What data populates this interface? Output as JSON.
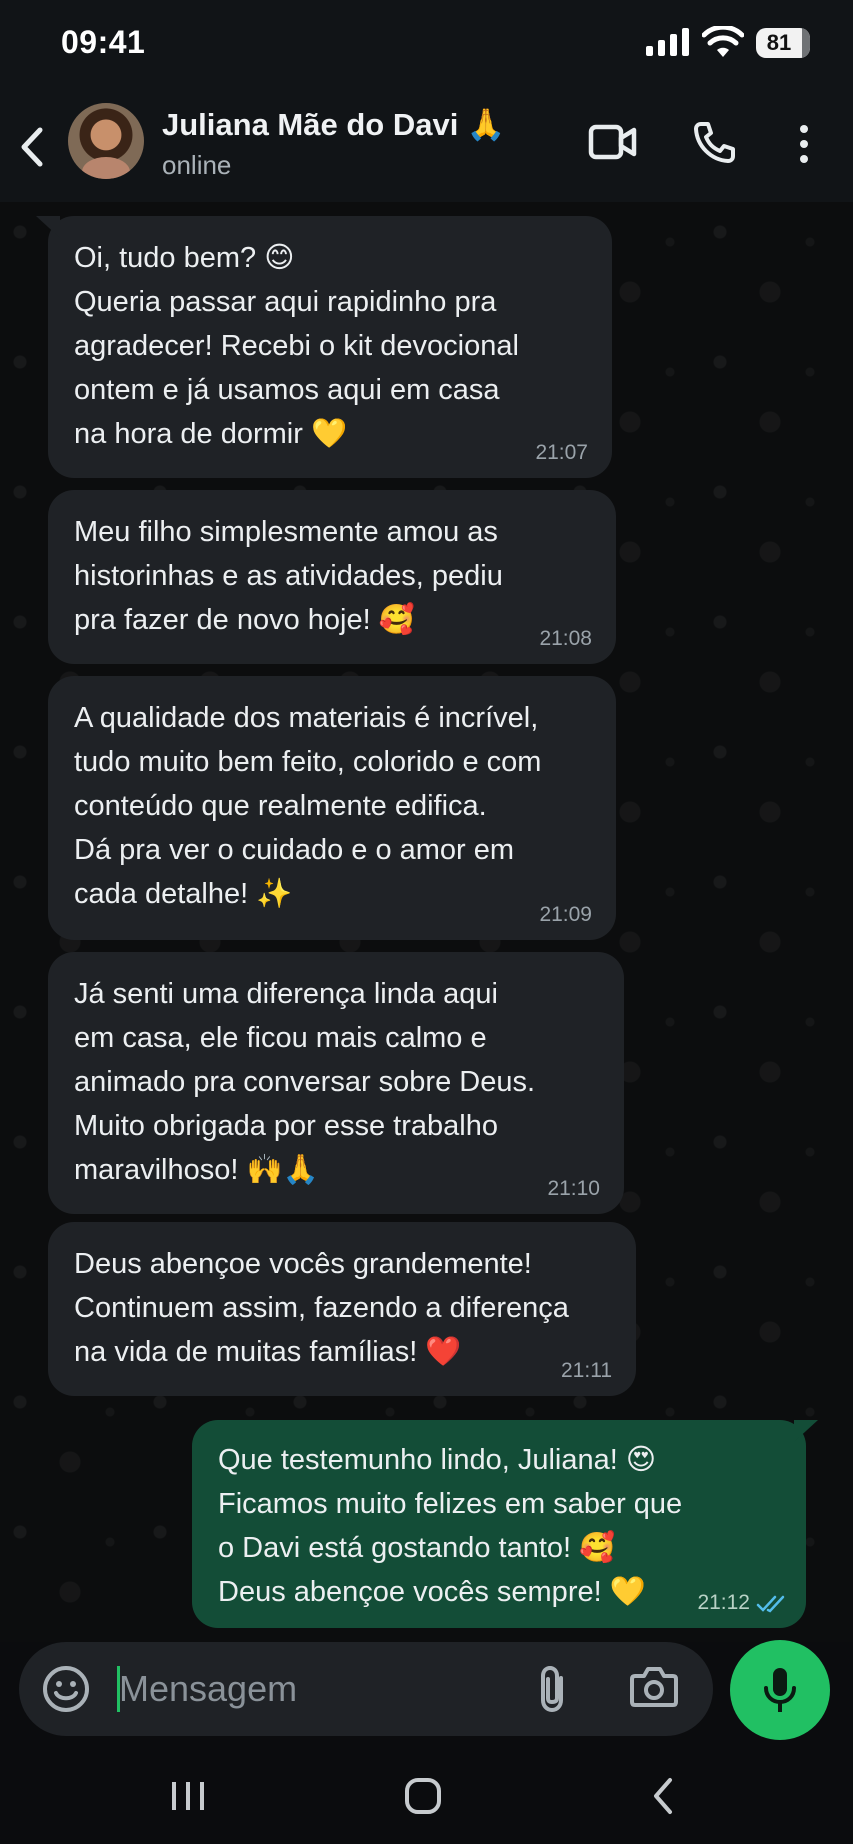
{
  "status_bar": {
    "time": "09:41",
    "battery": "81",
    "signal_icon": "signal-bars-icon",
    "wifi_icon": "wifi-icon"
  },
  "header": {
    "contact_name": "Juliana Mãe do Davi 🙏",
    "status": "online",
    "back_icon": "arrow-left-icon",
    "video_icon": "video-camera-icon",
    "call_icon": "phone-icon",
    "menu_icon": "more-vertical-icon"
  },
  "messages": [
    {
      "direction": "incoming",
      "text": "Oi, tudo bem? 😊\nQueria passar aqui rapidinho pra\nagradecer! Recebi o kit devocional\nontem e já usamos aqui em casa\nna hora de dormir 💛",
      "time": "21:07"
    },
    {
      "direction": "incoming",
      "text": "Meu filho simplesmente amou as\nhistorinhas e as atividades, pediu\npra fazer de novo hoje! 🥰",
      "time": "21:08"
    },
    {
      "direction": "incoming",
      "text": "A qualidade dos materiais é incrível,\ntudo muito bem feito, colorido e com\nconteúdo que realmente edifica.\nDá pra ver o cuidado e o amor em\ncada detalhe! ✨",
      "time": "21:09"
    },
    {
      "direction": "incoming",
      "text": "Já senti uma diferença linda aqui\nem casa, ele ficou mais calmo e\nanimado pra conversar sobre Deus.\nMuito obrigada por esse trabalho\nmaravilhoso! 🙌🙏",
      "time": "21:10"
    },
    {
      "direction": "incoming",
      "text": "Deus abençoe vocês grandemente!\nContinuem assim, fazendo a diferença\nna vida de muitas famílias! ❤️",
      "time": "21:11"
    },
    {
      "direction": "outgoing",
      "text": "Que testemunho lindo, Juliana! 😍\nFicamos muito felizes em saber que\no Davi está gostando tanto! 🥰\nDeus abençoe vocês sempre! 💛",
      "time": "21:12",
      "read_status": "read",
      "read_color": "#53bdeb"
    }
  ],
  "composer": {
    "placeholder": "Mensagem",
    "emoji_icon": "smiley-icon",
    "attach_icon": "paperclip-icon",
    "camera_icon": "camera-icon",
    "mic_icon": "microphone-icon"
  },
  "nav_bar": {
    "recents_icon": "recents-icon",
    "home_icon": "home-icon",
    "back_icon": "back-chevron-icon"
  },
  "colors": {
    "background": "#0c0d0e",
    "incoming_bubble": "#1f2226",
    "outgoing_bubble": "#134d37",
    "accent_green": "#21c063"
  }
}
